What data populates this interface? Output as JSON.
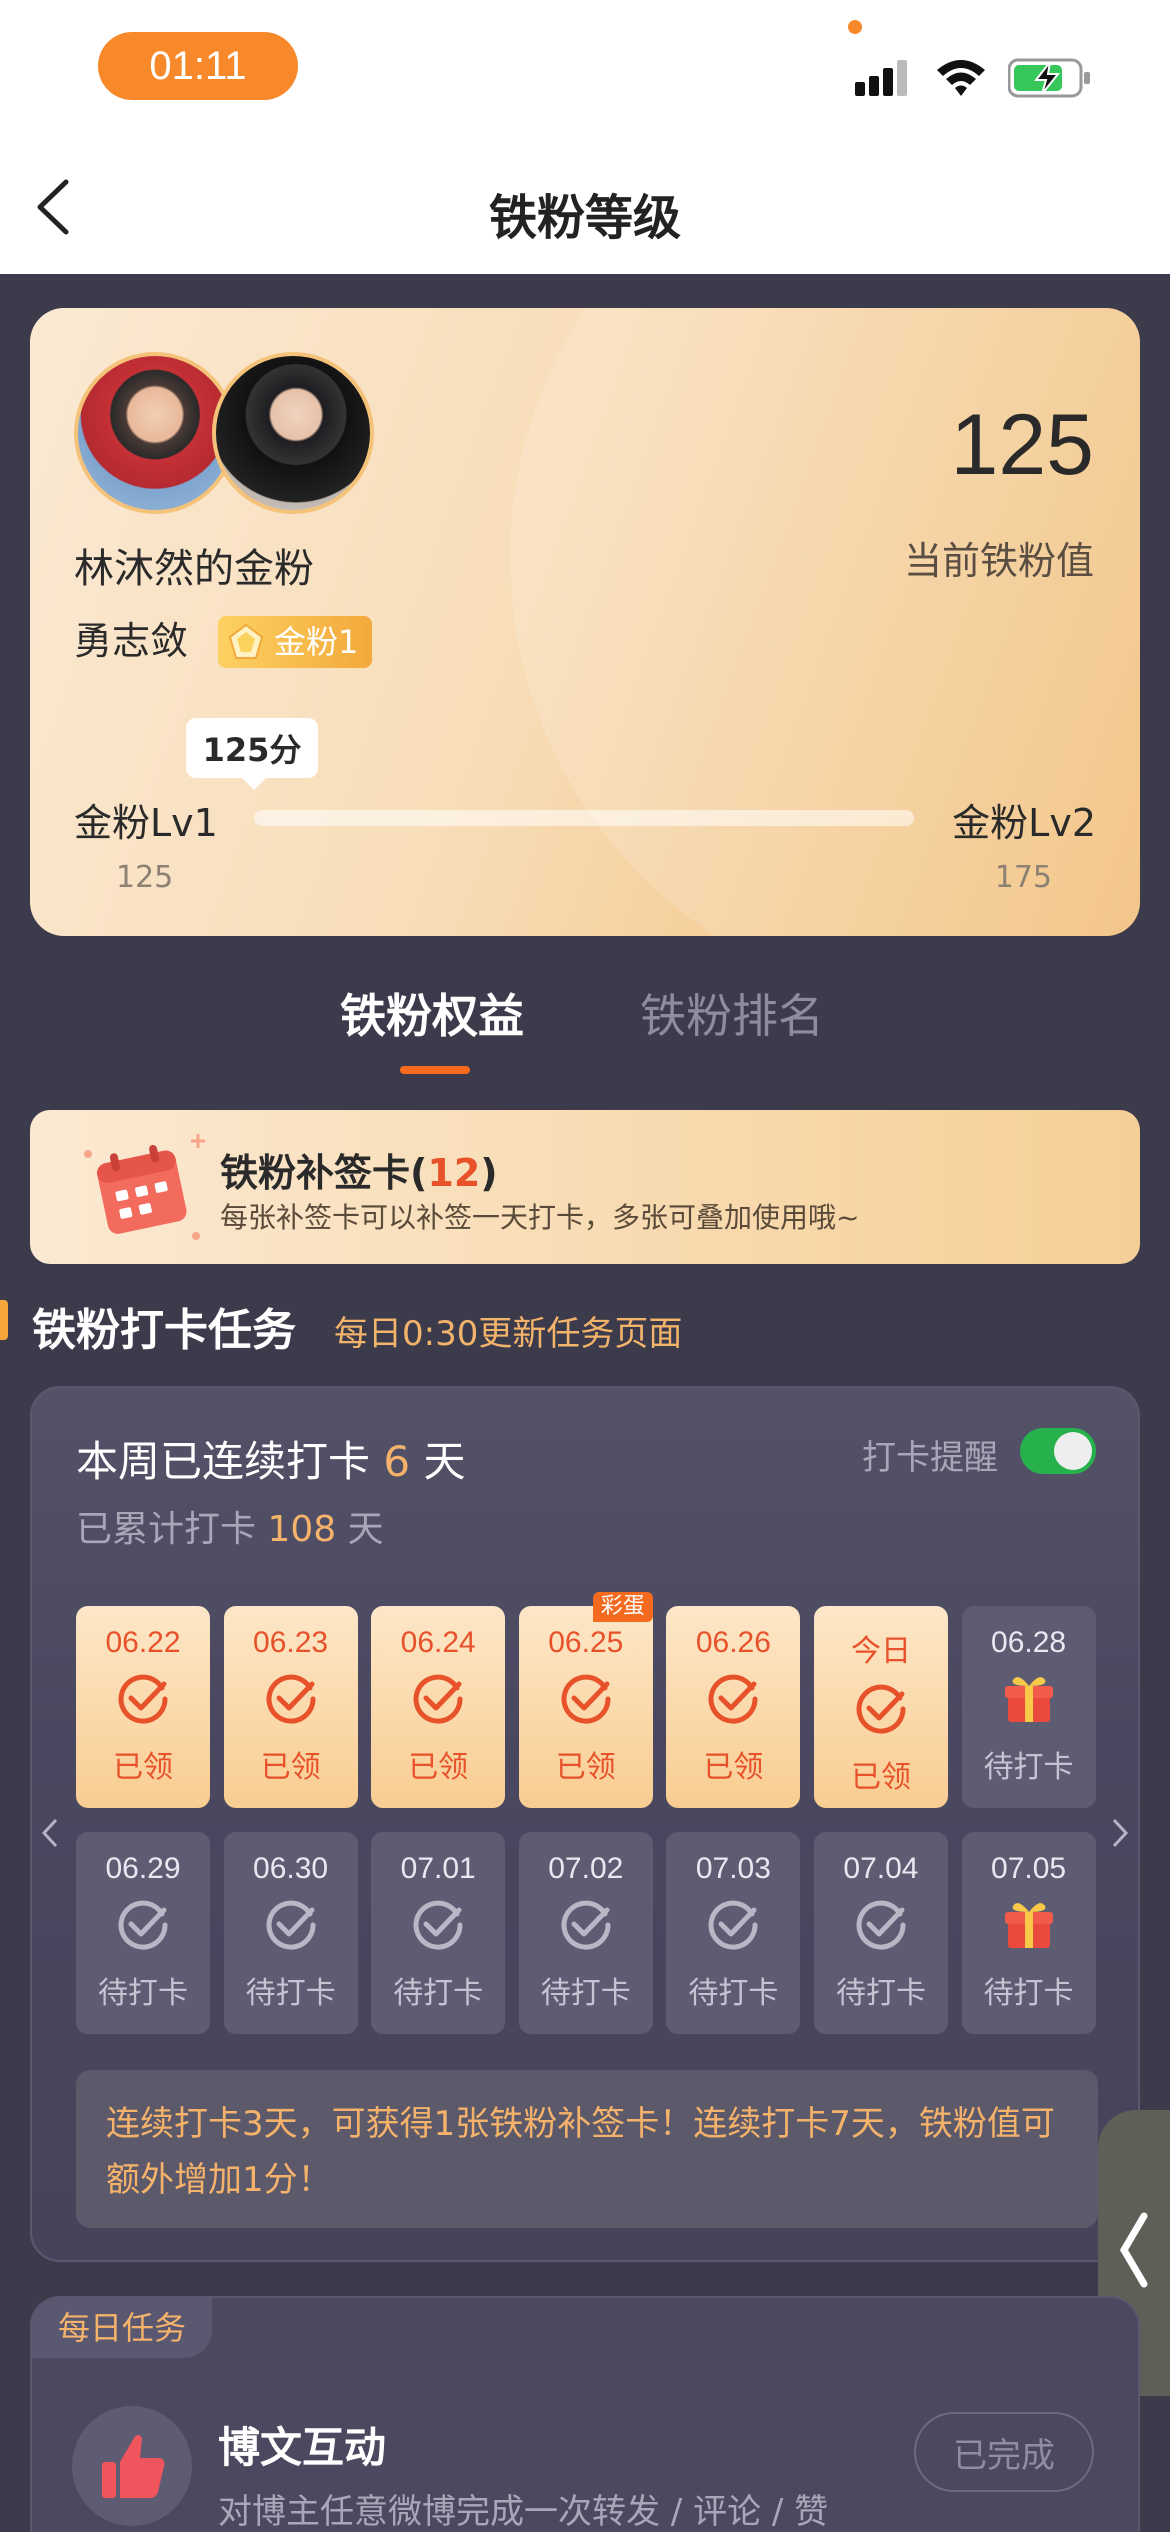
{
  "status_bar": {
    "time": "01:11"
  },
  "nav": {
    "title": "铁粉等级"
  },
  "fan_card": {
    "title": "林沐然的金粉",
    "user_name": "勇志敛",
    "badge": "金粉1",
    "score": "125",
    "score_label": "当前铁粉值",
    "tooltip": "125分",
    "level_current": "金粉Lv1",
    "level_next": "金粉Lv2",
    "level_current_min": "125",
    "level_next_min": "175",
    "progress": 0.0
  },
  "tabs": {
    "benefits": "铁粉权益",
    "ranking": "铁粉排名"
  },
  "makeup_card": {
    "title": "铁粉补签卡",
    "count": "12",
    "description": "每张补签卡可以补签一天打卡，多张可叠加使用哦~"
  },
  "checkin_section": {
    "title": "铁粉打卡任务",
    "subtitle": "每日0:30更新任务页面"
  },
  "checkin": {
    "streak_prefix": "本周已连续打卡",
    "streak_days": "6",
    "streak_suffix": "天",
    "total_prefix": "已累计打卡",
    "total_days": "108",
    "total_suffix": "天",
    "reminder_label": "打卡提醒",
    "reminder_on": true,
    "days": [
      {
        "date": "06.22",
        "status": "已领",
        "done": true,
        "icon": "check-circle-icon"
      },
      {
        "date": "06.23",
        "status": "已领",
        "done": true,
        "icon": "check-circle-icon"
      },
      {
        "date": "06.24",
        "status": "已领",
        "done": true,
        "icon": "check-circle-icon"
      },
      {
        "date": "06.25",
        "status": "已领",
        "done": true,
        "icon": "check-circle-icon",
        "tag": "彩蛋"
      },
      {
        "date": "06.26",
        "status": "已领",
        "done": true,
        "icon": "check-circle-icon"
      },
      {
        "date": "今日",
        "status": "已领",
        "done": true,
        "icon": "check-circle-icon"
      },
      {
        "date": "06.28",
        "status": "待打卡",
        "done": false,
        "icon": "gift-icon"
      },
      {
        "date": "06.29",
        "status": "待打卡",
        "done": false,
        "icon": "check-circle-icon"
      },
      {
        "date": "06.30",
        "status": "待打卡",
        "done": false,
        "icon": "check-circle-icon"
      },
      {
        "date": "07.01",
        "status": "待打卡",
        "done": false,
        "icon": "check-circle-icon"
      },
      {
        "date": "07.02",
        "status": "待打卡",
        "done": false,
        "icon": "check-circle-icon"
      },
      {
        "date": "07.03",
        "status": "待打卡",
        "done": false,
        "icon": "check-circle-icon"
      },
      {
        "date": "07.04",
        "status": "待打卡",
        "done": false,
        "icon": "check-circle-icon"
      },
      {
        "date": "07.05",
        "status": "待打卡",
        "done": false,
        "icon": "gift-icon"
      }
    ],
    "notice": "连续打卡3天，可获得1张铁粉补签卡！连续打卡7天，铁粉值可额外增加1分！"
  },
  "daily_tasks": {
    "tag": "每日任务",
    "items": [
      {
        "title": "博文互动",
        "description": "对博主任意微博完成一次转发 / 评论 / 赞",
        "button": "已完成",
        "icon": "thumbs-up-icon"
      }
    ]
  },
  "colors": {
    "accent": "#f7892b",
    "highlight": "#f5b26b",
    "done_text": "#e8522b",
    "toggle_on": "#27b14d"
  }
}
